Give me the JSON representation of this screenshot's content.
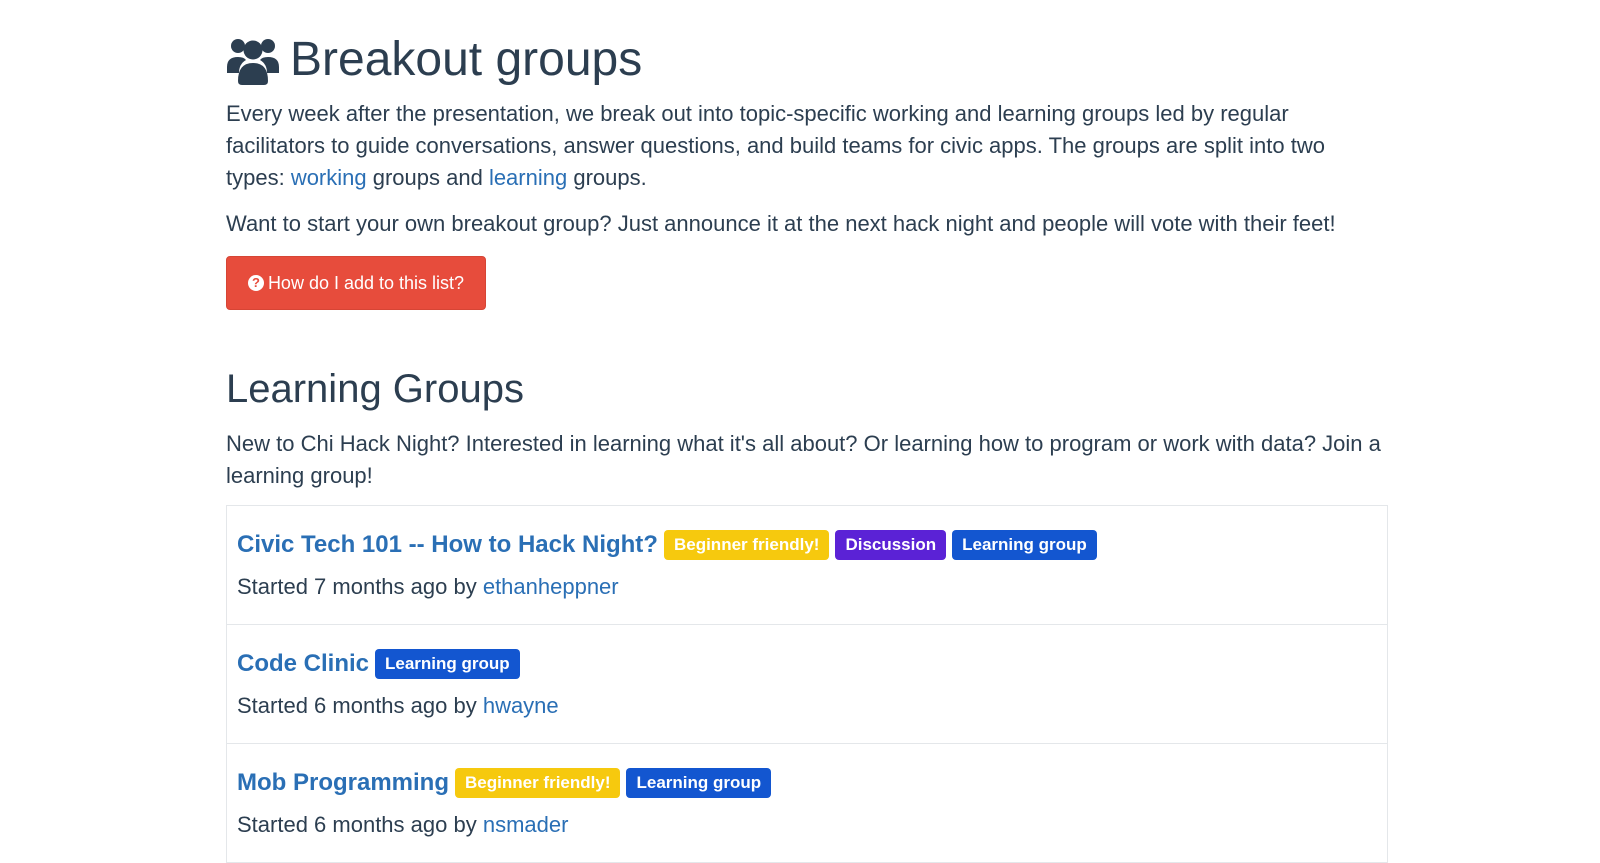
{
  "page": {
    "title": "Breakout groups",
    "title_icon": "users-icon",
    "intro": {
      "text_before_working": "Every week after the presentation, we break out into topic-specific working and learning groups led by regular facilitators to guide conversations, answer questions, and build teams for civic apps. The groups are split into two types: ",
      "working_link": "working",
      "text_between": " groups and ",
      "learning_link": "learning",
      "text_after": " groups."
    },
    "intro2": "Want to start your own breakout group? Just announce it at the next hack night and people will vote with their feet!",
    "add_button": {
      "icon": "question-circle-icon",
      "label": "How do I add to this list?"
    }
  },
  "learning_section": {
    "title": "Learning Groups",
    "description": "New to Chi Hack Night? Interested in learning what it's all about? Or learning how to program or work with data? Join a learning group!",
    "groups": [
      {
        "name": "Civic Tech 101 -- How to Hack Night?",
        "tags": [
          "Beginner friendly!",
          "Discussion",
          "Learning group"
        ],
        "started_prefix": "Started 7 months ago by ",
        "author": "ethanheppner"
      },
      {
        "name": "Code Clinic",
        "tags": [
          "Learning group"
        ],
        "started_prefix": "Started 6 months ago by ",
        "author": "hwayne"
      },
      {
        "name": "Mob Programming",
        "tags": [
          "Beginner friendly!",
          "Learning group"
        ],
        "started_prefix": "Started 6 months ago by ",
        "author": "nsmader"
      }
    ]
  },
  "colors": {
    "link": "#2a6fb5",
    "button": "#e74c3c",
    "tag_beginner": "#f6c90e",
    "tag_discussion": "#5b22d6",
    "tag_learning": "#1356d0",
    "heading": "#2c3e50"
  }
}
